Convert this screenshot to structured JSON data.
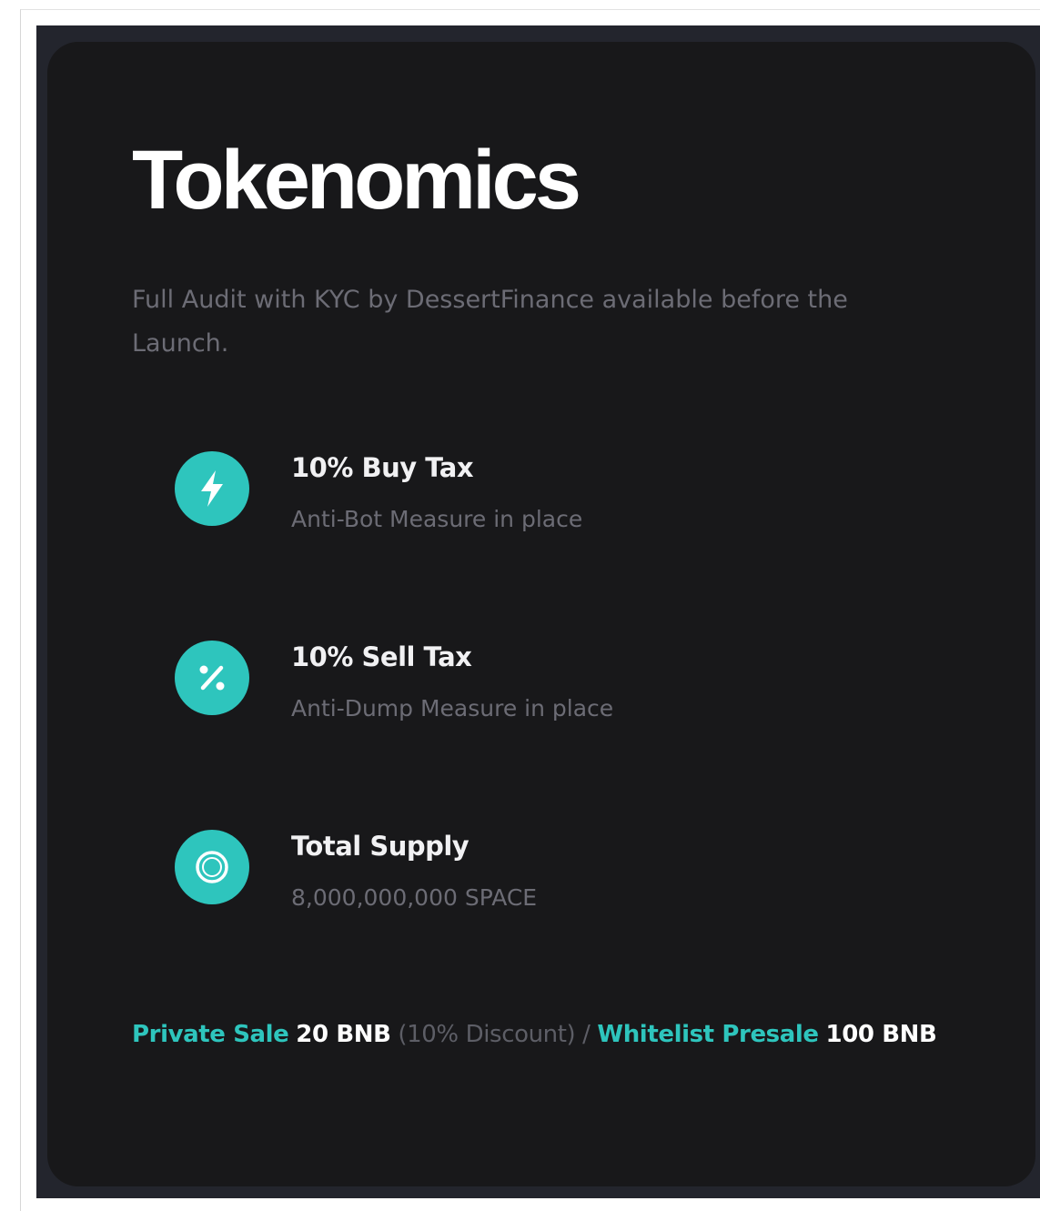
{
  "section": {
    "title": "Tokenomics",
    "subtitle": "Full Audit with KYC by DessertFinance available before the Launch."
  },
  "features": [
    {
      "icon": "lightning-icon",
      "title": "10% Buy Tax",
      "description": "Anti-Bot Measure in place"
    },
    {
      "icon": "percent-icon",
      "title": "10% Sell Tax",
      "description": "Anti-Dump Measure in place"
    },
    {
      "icon": "ring-icon",
      "title": "Total Supply",
      "description": "8,000,000,000 SPACE"
    }
  ],
  "sale": {
    "private_label": "Private Sale",
    "private_amount": "20 BNB",
    "private_note": "(10% Discount)",
    "separator": "/",
    "whitelist_label": "Whitelist Presale",
    "whitelist_amount": "100 BNB"
  },
  "colors": {
    "accent": "#2ec5bd",
    "card_background": "#18181a",
    "section_background": "#23252d",
    "muted_text": "#6c6c75"
  }
}
